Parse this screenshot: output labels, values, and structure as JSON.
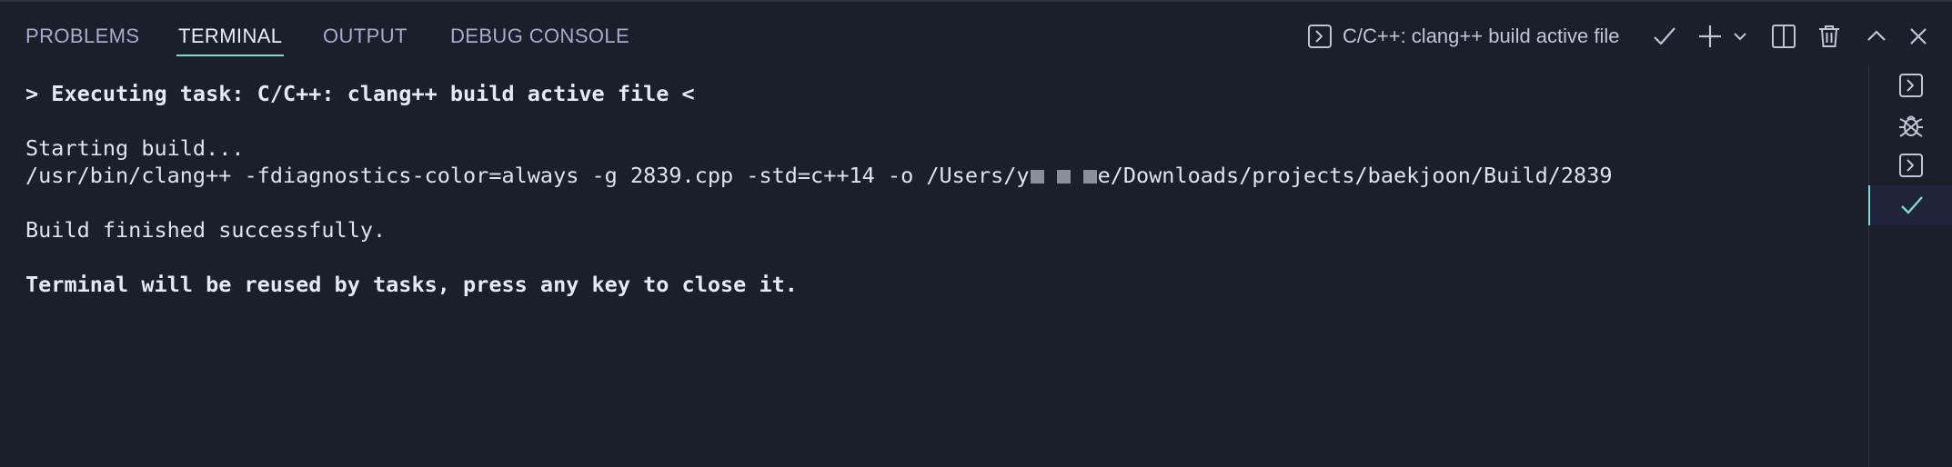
{
  "tabs": [
    {
      "label": "PROBLEMS",
      "active": false
    },
    {
      "label": "TERMINAL",
      "active": true
    },
    {
      "label": "OUTPUT",
      "active": false
    },
    {
      "label": "DEBUG CONSOLE",
      "active": false
    }
  ],
  "toolbar": {
    "task_label": "C/C++: clang++ build active file",
    "icons": [
      "terminal-icon",
      "check-icon",
      "plus-icon",
      "chevron-down-icon",
      "split-icon",
      "trash-icon",
      "chevron-up-icon",
      "close-icon"
    ]
  },
  "terminal": {
    "executing_line": "> Executing task: C/C++: clang++ build active file <",
    "starting_line": "Starting build...",
    "command_prefix": "/usr/bin/clang++ -fdiagnostics-color=always -g 2839.cpp -std=c++14 -o /Users/y",
    "command_suffix": "e/Downloads/projects/baekjoon/Build/2839",
    "finished_line": "Build finished successfully.",
    "reuse_line": "Terminal will be reused by tasks, press any key to close it."
  },
  "side_list": [
    {
      "icon": "terminal-icon",
      "active": false
    },
    {
      "icon": "debug-icon",
      "active": false
    },
    {
      "icon": "terminal-icon",
      "active": false
    },
    {
      "icon": "check-icon",
      "active": true
    }
  ],
  "colors": {
    "background": "#1b1e2b",
    "accent": "#7fdbca",
    "text": "#dfe3ee",
    "tab_inactive": "#a6accd"
  }
}
